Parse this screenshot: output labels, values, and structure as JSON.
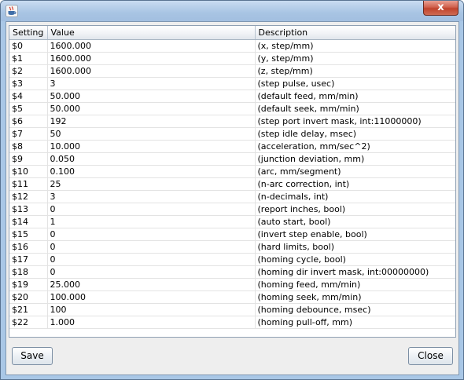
{
  "window": {
    "title": "",
    "close_glyph": "x",
    "icon": "java-cup-icon"
  },
  "table": {
    "headers": [
      "Setting",
      "Value",
      "Description"
    ],
    "rows": [
      [
        "$0",
        "1600.000",
        "(x, step/mm)"
      ],
      [
        "$1",
        "1600.000",
        "(y, step/mm)"
      ],
      [
        "$2",
        "1600.000",
        "(z, step/mm)"
      ],
      [
        "$3",
        "3",
        "(step pulse, usec)"
      ],
      [
        "$4",
        "50.000",
        "(default feed, mm/min)"
      ],
      [
        "$5",
        "50.000",
        "(default seek, mm/min)"
      ],
      [
        "$6",
        "192",
        "(step port invert mask, int:11000000)"
      ],
      [
        "$7",
        "50",
        "(step idle delay, msec)"
      ],
      [
        "$8",
        "10.000",
        "(acceleration, mm/sec^2)"
      ],
      [
        "$9",
        "0.050",
        "(junction deviation, mm)"
      ],
      [
        "$10",
        "0.100",
        "(arc, mm/segment)"
      ],
      [
        "$11",
        "25",
        "(n-arc correction, int)"
      ],
      [
        "$12",
        "3",
        "(n-decimals, int)"
      ],
      [
        "$13",
        "0",
        "(report inches, bool)"
      ],
      [
        "$14",
        "1",
        "(auto start, bool)"
      ],
      [
        "$15",
        "0",
        "(invert step enable, bool)"
      ],
      [
        "$16",
        "0",
        "(hard limits, bool)"
      ],
      [
        "$17",
        "0",
        "(homing cycle, bool)"
      ],
      [
        "$18",
        "0",
        "(homing dir invert mask, int:00000000)"
      ],
      [
        "$19",
        "25.000",
        "(homing feed, mm/min)"
      ],
      [
        "$20",
        "100.000",
        "(homing seek, mm/min)"
      ],
      [
        "$21",
        "100",
        "(homing debounce, msec)"
      ],
      [
        "$22",
        "1.000",
        "(homing pull-off, mm)"
      ]
    ]
  },
  "buttons": {
    "save_label": "Save",
    "close_label": "Close"
  }
}
